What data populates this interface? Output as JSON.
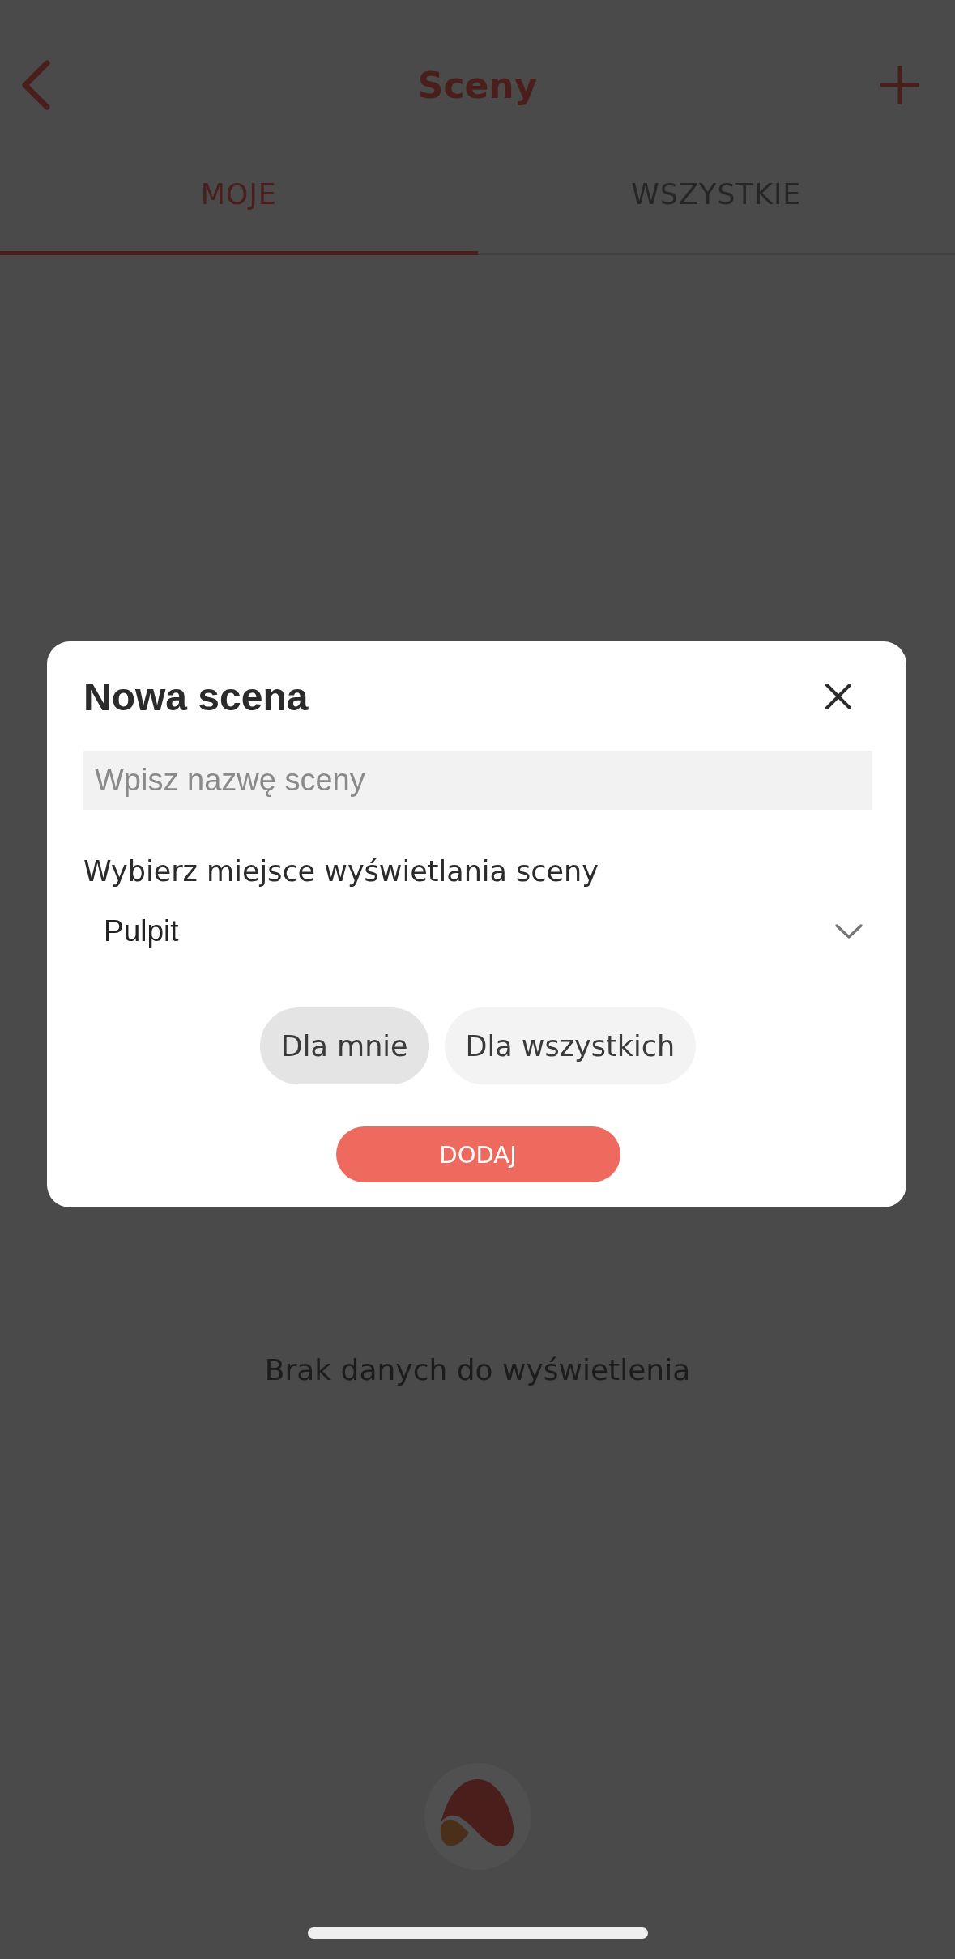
{
  "header": {
    "title": "Sceny"
  },
  "tabs": [
    {
      "label": "MOJE",
      "selected": true
    },
    {
      "label": "WSZYSTKIE",
      "selected": false
    }
  ],
  "empty_message": "Brak danych do wyświetlenia",
  "dialog": {
    "title": "Nowa scena",
    "name_field": {
      "placeholder": "Wpisz nazwę sceny"
    },
    "location_label": "Wybierz miejsce wyświetlania sceny",
    "location_select": {
      "value": "Pulpit"
    },
    "audience_options": [
      {
        "label": "Dla mnie",
        "selected": true
      },
      {
        "label": "Dla wszystkich",
        "selected": false
      }
    ],
    "submit_button": "DODAJ"
  }
}
